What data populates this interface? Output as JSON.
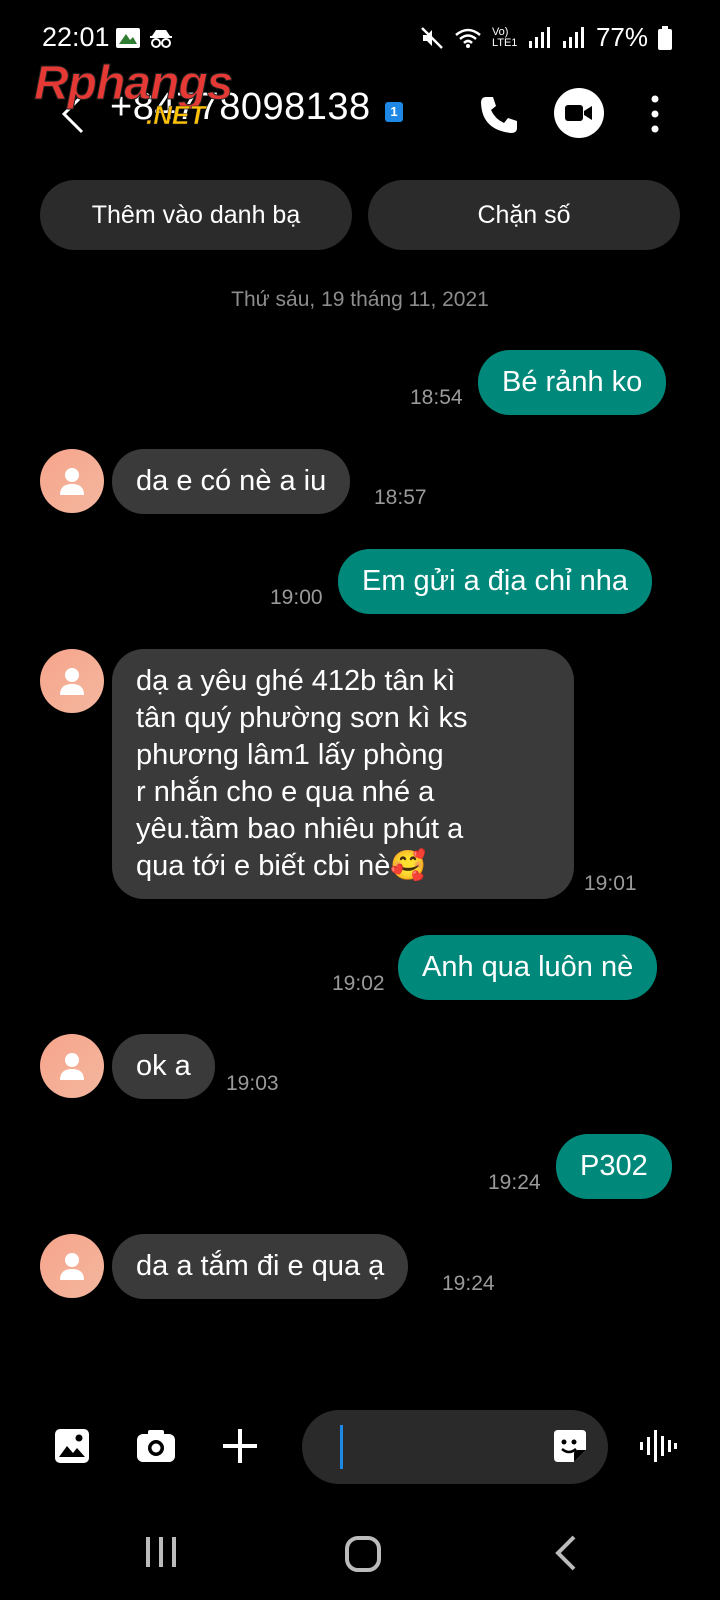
{
  "status_bar": {
    "time": "22:01",
    "battery": "77%",
    "network_label": "Vo) LTE1"
  },
  "header": {
    "contact": "+84778098138",
    "sim_badge": "1",
    "watermark_main": "Rphangs",
    "watermark_sub": ".NET",
    "icons": [
      "back-arrow-icon",
      "phone-icon",
      "video-call-icon",
      "more-icon"
    ]
  },
  "actions": {
    "add_contact": "Thêm vào danh bạ",
    "block_number": "Chặn số"
  },
  "date_divider": "Thứ sáu, 19 tháng 11, 2021",
  "messages": [
    {
      "dir": "out",
      "text": "Bé rảnh ko",
      "time": "18:54"
    },
    {
      "dir": "in",
      "text": "da e có nè a iu",
      "time": "18:57"
    },
    {
      "dir": "out",
      "text": "Em gửi a địa chỉ nha",
      "time": "19:00"
    },
    {
      "dir": "in",
      "lines": [
        "dạ a yêu ghé 412b tân kì",
        "tân quý phường sơn kì ks",
        "phương lâm1 lấy phòng",
        "r nhắn cho e qua nhé a",
        "yêu.tầm bao nhiêu phút a",
        "qua tới e biết cbi nè🥰"
      ],
      "time": "19:01"
    },
    {
      "dir": "out",
      "text": "Anh qua luôn nè",
      "time": "19:02"
    },
    {
      "dir": "in",
      "text": "ok a",
      "time": "19:03"
    },
    {
      "dir": "out",
      "text": "P302",
      "time": "19:24"
    },
    {
      "dir": "in",
      "text": "da a tắm đi e qua ạ",
      "time": "19:24"
    }
  ],
  "composer": {
    "icons": [
      "gallery-icon",
      "camera-icon",
      "plus-icon",
      "sticker-icon",
      "voice-icon"
    ]
  },
  "colors": {
    "outgoing": "#00897b",
    "incoming": "#3a3a3a",
    "background": "#000000"
  }
}
